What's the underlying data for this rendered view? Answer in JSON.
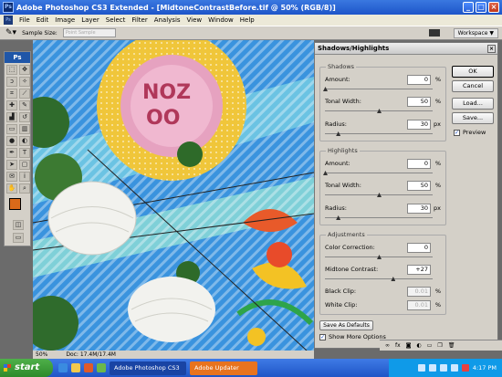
{
  "window": {
    "title": "Adobe Photoshop CS3 Extended - [MidtoneContrastBefore.tif @ 50% (RGB/8)]"
  },
  "menu": [
    "File",
    "Edit",
    "Image",
    "Layer",
    "Select",
    "Filter",
    "Analysis",
    "View",
    "Window",
    "Help"
  ],
  "options_bar": {
    "sample_size_label": "Sample Size:",
    "sample_size_value": "Point Sample",
    "workspace_label": "Workspace ▼"
  },
  "toolbox": {
    "logo": "Ps"
  },
  "status_bar": {
    "zoom": "50%",
    "doc": "Doc: 17.4M/17.4M"
  },
  "dialog": {
    "title": "Shadows/Highlights",
    "shadows": {
      "label": "Shadows",
      "amount_label": "Amount:",
      "amount": "0",
      "amount_unit": "%",
      "tonal_label": "Tonal Width:",
      "tonal": "50",
      "tonal_unit": "%",
      "radius_label": "Radius:",
      "radius": "30",
      "radius_unit": "px"
    },
    "highlights": {
      "label": "Highlights",
      "amount_label": "Amount:",
      "amount": "0",
      "amount_unit": "%",
      "tonal_label": "Tonal Width:",
      "tonal": "50",
      "tonal_unit": "%",
      "radius_label": "Radius:",
      "radius": "30",
      "radius_unit": "px"
    },
    "adjustments": {
      "label": "Adjustments",
      "color_label": "Color Correction:",
      "color": "0",
      "midtone_label": "Midtone Contrast:",
      "midtone": "+27",
      "black_label": "Black Clip:",
      "black": "0.01",
      "black_unit": "%",
      "white_label": "White Clip:",
      "white": "0.01",
      "white_unit": "%"
    },
    "sliders": {
      "shadows_amount": 0.0,
      "shadows_tonal": 0.5,
      "shadows_radius": 0.12,
      "highlights_amount": 0.0,
      "highlights_tonal": 0.5,
      "highlights_radius": 0.12,
      "color": 0.5,
      "midtone": 0.63
    },
    "buttons": {
      "ok": "OK",
      "cancel": "Cancel",
      "load": "Load...",
      "save": "Save...",
      "save_defaults": "Save As Defaults"
    },
    "preview_label": "Preview",
    "show_more_label": "Show More Options"
  },
  "taskbar": {
    "start": "start",
    "tasks": [
      "Adobe Photoshop CS3 ...",
      "Adobe Updater"
    ],
    "clock": "4:17 PM"
  }
}
